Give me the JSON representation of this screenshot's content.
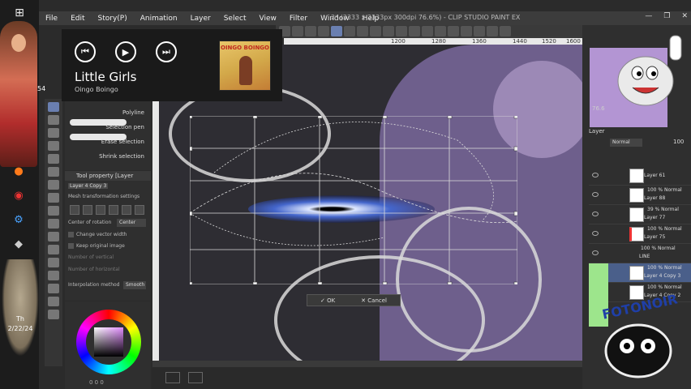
{
  "window": {
    "title": "2* (3333 x 3333px 300dpi 76.6%) - CLIP STUDIO PAINT EX"
  },
  "menu": [
    "File",
    "Edit",
    "Story(P)",
    "Animation",
    "Layer",
    "Select",
    "View",
    "Filter",
    "Window",
    "Help"
  ],
  "media": {
    "song_title": "Little Girls",
    "artist": "Oingo Boingo",
    "album_art_text": "OINGO BOINGO",
    "prev_icon": "skip-previous-icon",
    "play_icon": "play-icon",
    "next_icon": "skip-next-icon"
  },
  "taskbar": {
    "badge": "54",
    "clock_day": "Th",
    "clock_date": "2/22/24"
  },
  "ruler": [
    "1200",
    "1280",
    "1360",
    "1440",
    "1520",
    "1600"
  ],
  "subtools": {
    "items": [
      "Polyline",
      "Selection pen",
      "Erase selection",
      "Shrink selection"
    ]
  },
  "tool_property": {
    "header": "Tool property [Layer",
    "layer_name": "Layer 4 Copy 3",
    "mode": "Mesh transformation settings",
    "center_label": "Center of rotation",
    "center_value": "Center",
    "change_vector": "Change vector width",
    "keep_original": "Keep original image",
    "num_v": "Number of vertical",
    "num_h": "Number of horizontal",
    "interp_label": "Interpolation method",
    "interp_value": "Smooth"
  },
  "color": {
    "values": "0   0   0"
  },
  "dialog": {
    "ok": "OK",
    "cancel": "Cancel"
  },
  "layers": {
    "zoom": "76.6",
    "header": "Layer",
    "mode": "Normal",
    "opacity": "100",
    "rows": [
      {
        "line1": "Layer 61",
        "line2": ""
      },
      {
        "line1": "100 % Normal",
        "line2": "Layer 88"
      },
      {
        "line1": "39 % Normal",
        "line2": "Layer 77"
      },
      {
        "line1": "100 % Normal",
        "line2": "Layer 75"
      },
      {
        "line1": "100 % Normal",
        "line2": "LINE"
      },
      {
        "line1": "100 % Normal",
        "line2": "Layer 4 Copy 3"
      },
      {
        "line1": "100 % Normal",
        "line2": "Layer 4 Copy 2"
      }
    ],
    "sticker_text": "FOTONOIR"
  }
}
